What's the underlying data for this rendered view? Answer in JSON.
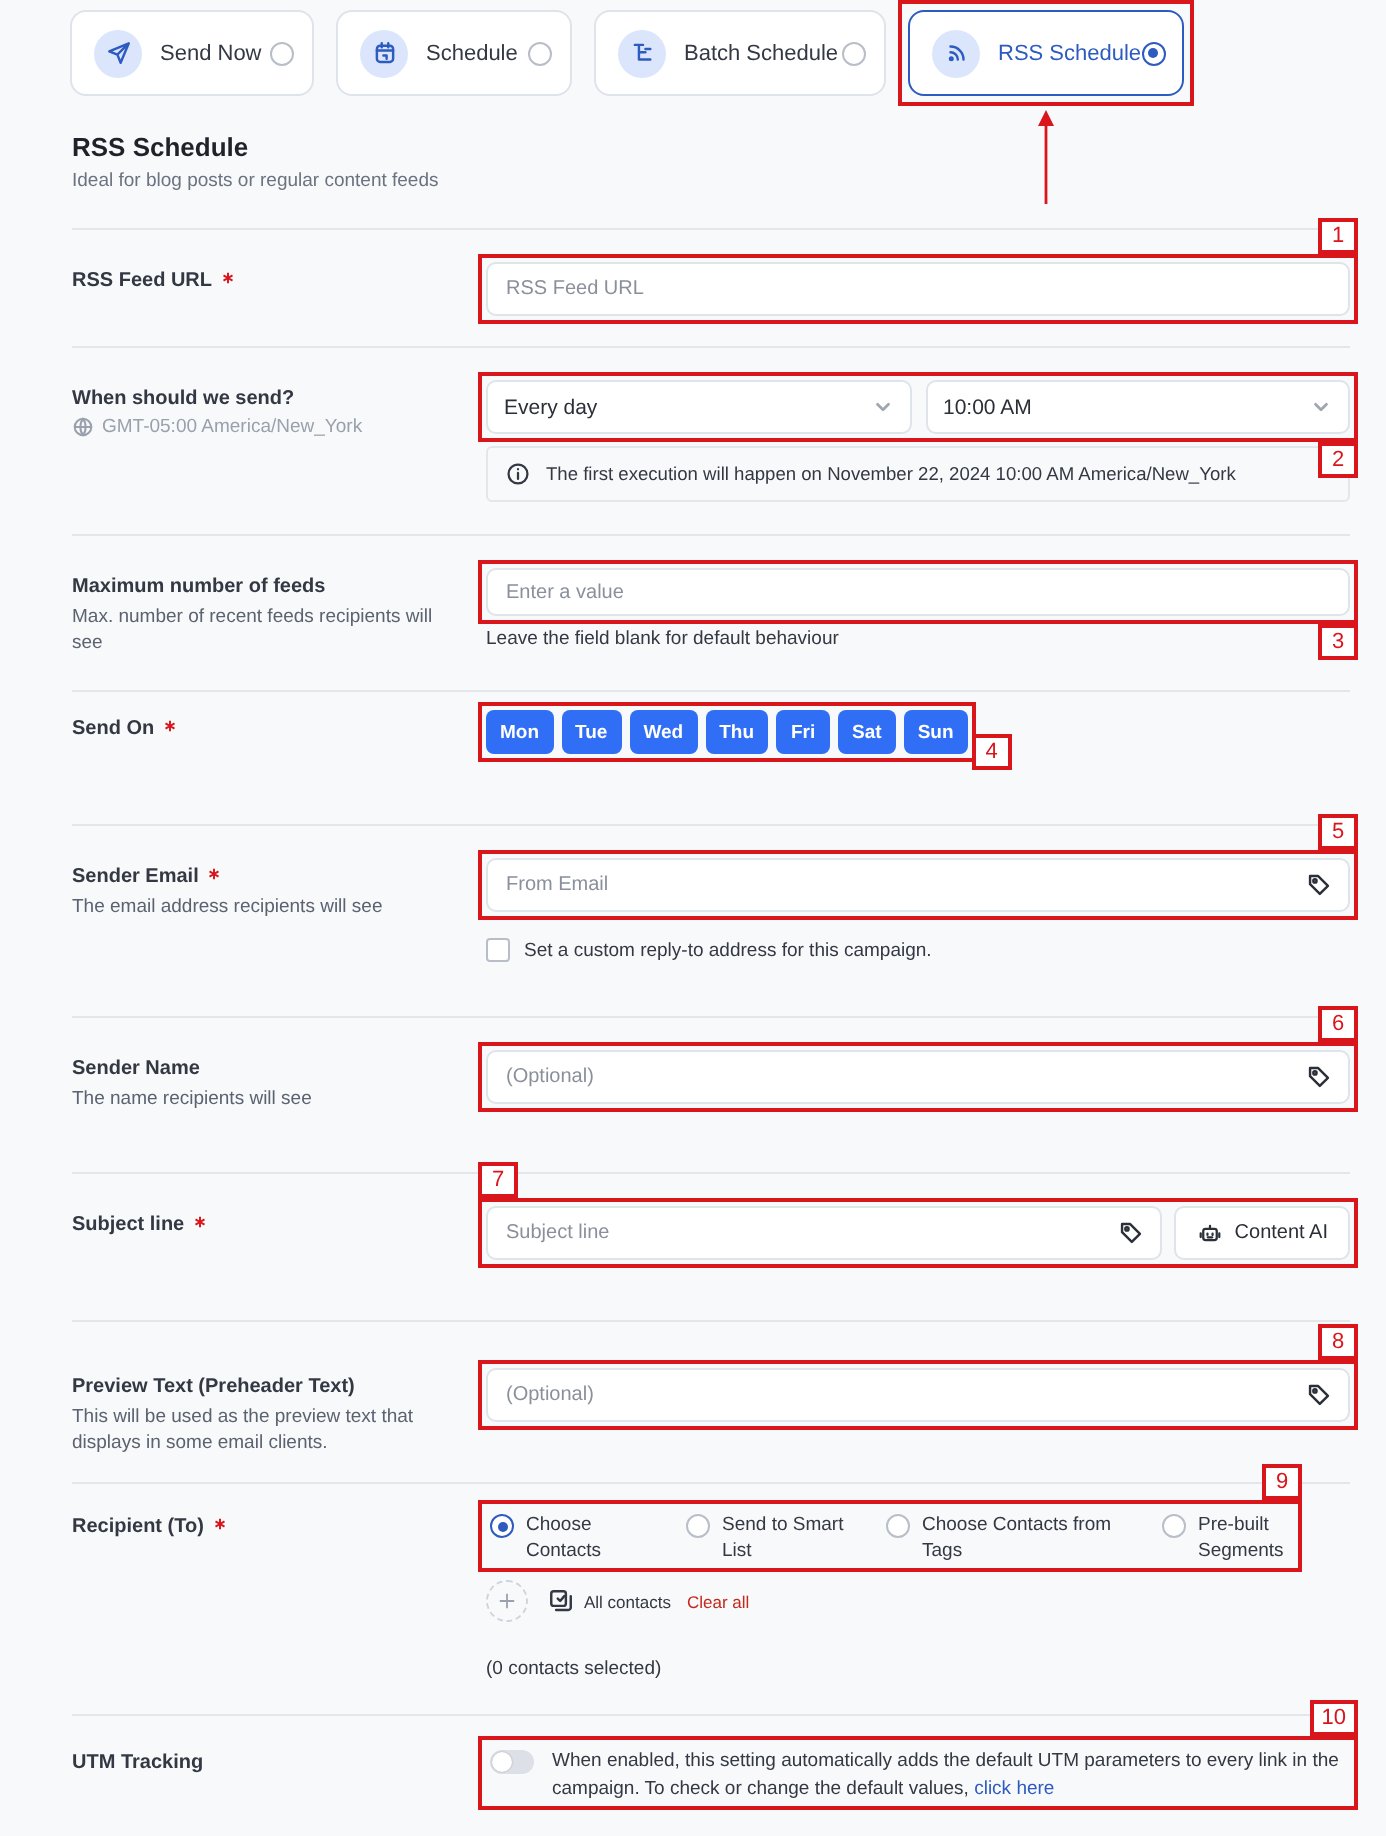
{
  "modes": [
    {
      "label": "Send Now",
      "selected": false
    },
    {
      "label": "Schedule",
      "selected": false
    },
    {
      "label": "Batch Schedule",
      "selected": false
    },
    {
      "label": "RSS Schedule",
      "selected": true,
      "highlighted": true
    }
  ],
  "heading": {
    "title": "RSS Schedule",
    "subtitle": "Ideal for blog posts or regular content feeds"
  },
  "rows": [
    {
      "kind": "text",
      "label": "RSS Feed URL",
      "required": true,
      "placeholder": "RSS Feed URL",
      "annotation": {
        "number": "1"
      }
    },
    {
      "kind": "schedule",
      "label": "When should we send?",
      "timezone": "GMT-05:00 America/New_York",
      "frequency": "Every day",
      "time": "10:00 AM",
      "info": "The first execution will happen on November 22, 2024 10:00 AM America/New_York",
      "annotation": {
        "number": "2"
      }
    },
    {
      "kind": "text",
      "label": "Maximum number of feeds",
      "description": "Max. number of recent feeds recipients will see",
      "placeholder": "Enter a value",
      "hint": "Leave the field blank for default behaviour",
      "annotation": {
        "number": "3"
      }
    },
    {
      "kind": "days",
      "label": "Send On",
      "required": true,
      "days": [
        {
          "label": "Mon",
          "selected": true
        },
        {
          "label": "Tue",
          "selected": true
        },
        {
          "label": "Wed",
          "selected": true
        },
        {
          "label": "Thu",
          "selected": true
        },
        {
          "label": "Fri",
          "selected": true
        },
        {
          "label": "Sat",
          "selected": true
        },
        {
          "label": "Sun",
          "selected": true
        }
      ],
      "annotation": {
        "number": "4"
      }
    },
    {
      "kind": "text",
      "label": "Sender Email",
      "required": true,
      "description": "The email address recipients will see",
      "placeholder": "From Email",
      "tag_icon": true,
      "checkbox": {
        "label": "Set a custom reply-to address for this campaign.",
        "checked": false
      },
      "annotation": {
        "number": "5"
      }
    },
    {
      "kind": "text",
      "label": "Sender Name",
      "description": "The name recipients will see",
      "placeholder": "(Optional)",
      "tag_icon": true,
      "annotation": {
        "number": "6"
      }
    },
    {
      "kind": "subject",
      "label": "Subject line",
      "required": true,
      "placeholder": "Subject line",
      "button": "Content AI",
      "annotation": {
        "number": "7"
      }
    },
    {
      "kind": "text",
      "label": "Preview Text (Preheader Text)",
      "description": "This will be used as the preview text that displays in some email clients.",
      "placeholder": "(Optional)",
      "tag_icon": true,
      "annotation": {
        "number": "8"
      }
    },
    {
      "kind": "recipients",
      "label": "Recipient (To)",
      "required": true,
      "options": [
        {
          "label": "Choose Contacts",
          "selected": true
        },
        {
          "label": "Send to Smart List",
          "selected": false
        },
        {
          "label": "Choose Contacts from Tags",
          "selected": false
        },
        {
          "label": "Pre-built Segments",
          "selected": false
        }
      ],
      "all_contacts": "All contacts",
      "clear": "Clear all",
      "count": "(0 contacts selected)",
      "annotation": {
        "number": "9"
      }
    },
    {
      "kind": "toggle",
      "label": "UTM Tracking",
      "on": false,
      "text": "When enabled, this setting automatically adds the default UTM parameters to every link in the campaign. To check or change the default values,",
      "link": "click here",
      "annotation": {
        "number": "10"
      }
    }
  ]
}
